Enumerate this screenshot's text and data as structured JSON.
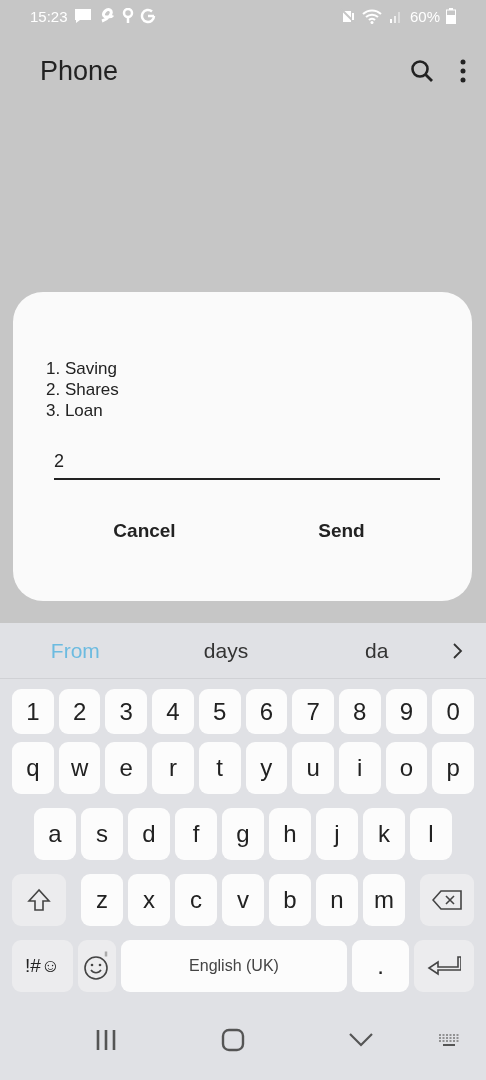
{
  "status_bar": {
    "time": "15:23",
    "battery": "60%"
  },
  "app_bar": {
    "title": "Phone"
  },
  "dialog": {
    "menu_lines": [
      "1. Saving",
      "2. Shares",
      "3. Loan"
    ],
    "input": {
      "value": "2"
    },
    "buttons": [
      "Cancel",
      "Send"
    ]
  },
  "keyboard": {
    "suggestions": [
      {
        "text": "From",
        "selected": true
      },
      {
        "text": "days",
        "selected": false
      },
      {
        "text": "da",
        "selected": false
      }
    ],
    "rows": [
      {
        "keys": [
          {
            "kind": "char",
            "label": "1"
          },
          {
            "kind": "char",
            "label": "2"
          },
          {
            "kind": "char",
            "label": "3"
          },
          {
            "kind": "char",
            "label": "4"
          },
          {
            "kind": "char",
            "label": "5"
          },
          {
            "kind": "char",
            "label": "6"
          },
          {
            "kind": "char",
            "label": "7"
          },
          {
            "kind": "char",
            "label": "8"
          },
          {
            "kind": "char",
            "label": "9"
          },
          {
            "kind": "char",
            "label": "0"
          }
        ]
      },
      {
        "keys": [
          {
            "kind": "char",
            "label": "q"
          },
          {
            "kind": "char",
            "label": "w"
          },
          {
            "kind": "char",
            "label": "e"
          },
          {
            "kind": "char",
            "label": "r"
          },
          {
            "kind": "char",
            "label": "t"
          },
          {
            "kind": "char",
            "label": "y"
          },
          {
            "kind": "char",
            "label": "u"
          },
          {
            "kind": "char",
            "label": "i"
          },
          {
            "kind": "char",
            "label": "o"
          },
          {
            "kind": "char",
            "label": "p"
          }
        ]
      },
      {
        "keys": [
          {
            "kind": "char",
            "label": "a"
          },
          {
            "kind": "char",
            "label": "s"
          },
          {
            "kind": "char",
            "label": "d"
          },
          {
            "kind": "char",
            "label": "f"
          },
          {
            "kind": "char",
            "label": "g"
          },
          {
            "kind": "char",
            "label": "h"
          },
          {
            "kind": "char",
            "label": "j"
          },
          {
            "kind": "char",
            "label": "k"
          },
          {
            "kind": "char",
            "label": "l"
          }
        ]
      },
      {
        "keys": [
          {
            "kind": "shift"
          },
          {
            "kind": "char",
            "label": "z"
          },
          {
            "kind": "char",
            "label": "x"
          },
          {
            "kind": "char",
            "label": "c"
          },
          {
            "kind": "char",
            "label": "v"
          },
          {
            "kind": "char",
            "label": "b"
          },
          {
            "kind": "char",
            "label": "n"
          },
          {
            "kind": "char",
            "label": "m"
          },
          {
            "kind": "backspace"
          }
        ]
      },
      {
        "keys": [
          {
            "kind": "symbols",
            "label": "!#☺"
          },
          {
            "kind": "emoji"
          },
          {
            "kind": "space",
            "label": "English (UK)"
          },
          {
            "kind": "char",
            "label": "."
          },
          {
            "kind": "enter"
          }
        ]
      }
    ]
  }
}
